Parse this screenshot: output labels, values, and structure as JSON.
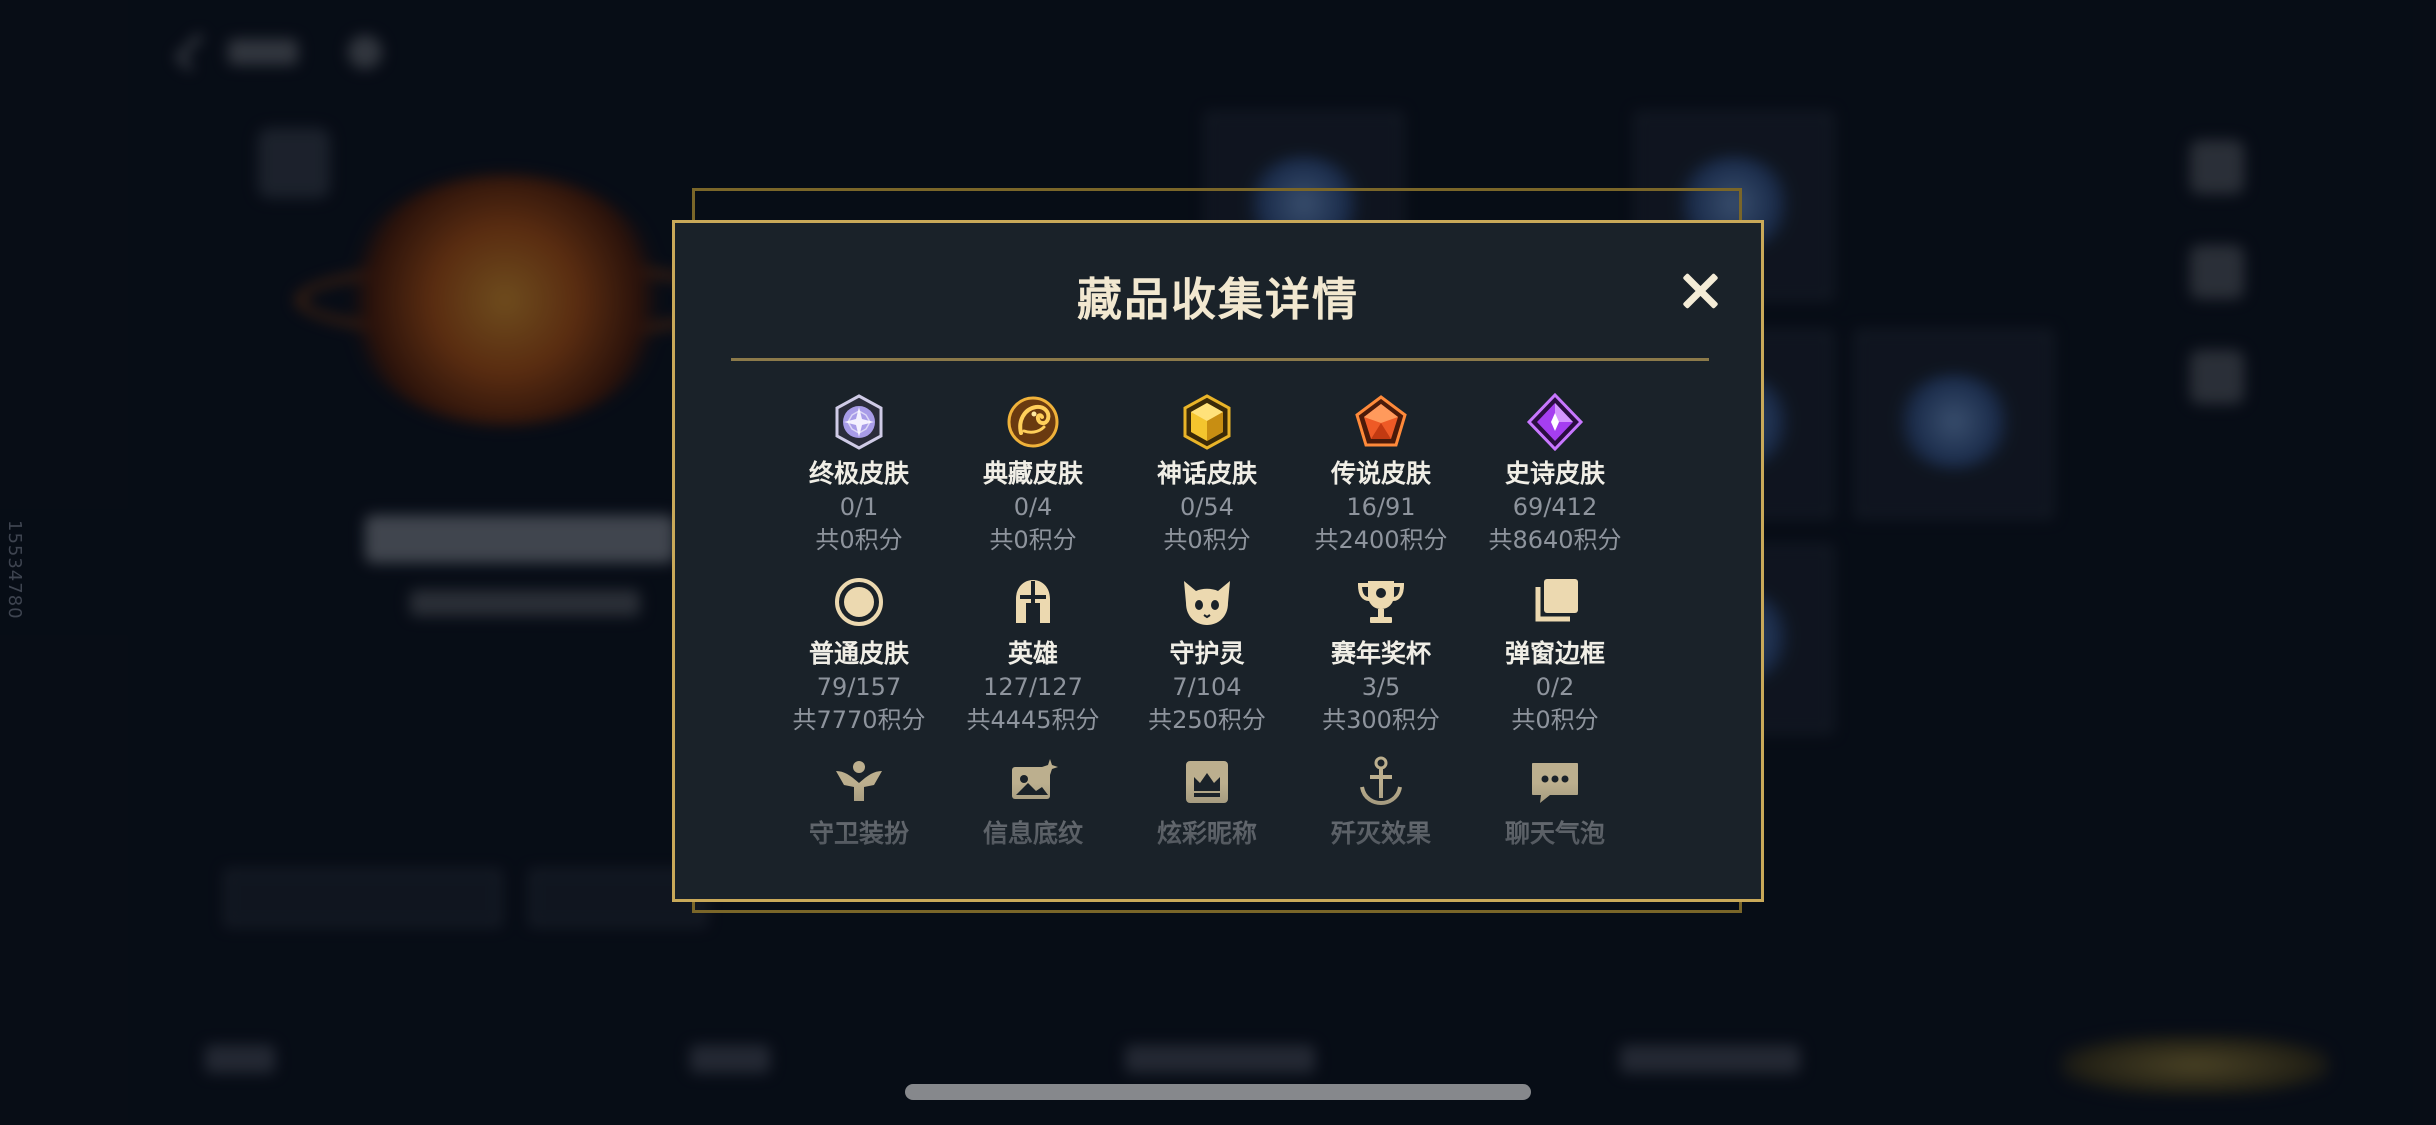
{
  "background": {
    "vertical_id": "15534780"
  },
  "modal": {
    "title": "藏品收集详情",
    "close_icon": "close-icon",
    "colors": {
      "border": "#c9a959",
      "panel": "#1a2229",
      "title": "#f2e8d0",
      "muted": "#8e949d"
    },
    "categories": [
      {
        "key": "ultimate",
        "icon": "ultimate-skin-gem-icon",
        "name": "终极皮肤",
        "count": "0/1",
        "score": "共0积分"
      },
      {
        "key": "collection",
        "icon": "collection-skin-dragon-icon",
        "name": "典藏皮肤",
        "count": "0/4",
        "score": "共0积分"
      },
      {
        "key": "mythic",
        "icon": "mythic-skin-gem-icon",
        "name": "神话皮肤",
        "count": "0/54",
        "score": "共0积分"
      },
      {
        "key": "legend",
        "icon": "legend-skin-gem-icon",
        "name": "传说皮肤",
        "count": "16/91",
        "score": "共2400积分"
      },
      {
        "key": "epic",
        "icon": "epic-skin-gem-icon",
        "name": "史诗皮肤",
        "count": "69/412",
        "score": "共8640积分"
      },
      {
        "key": "normal",
        "icon": "normal-skin-ring-icon",
        "name": "普通皮肤",
        "count": "79/157",
        "score": "共7770积分"
      },
      {
        "key": "hero",
        "icon": "hero-helmet-icon",
        "name": "英雄",
        "count": "127/127",
        "score": "共4445积分"
      },
      {
        "key": "spirit",
        "icon": "guardian-spirit-icon",
        "name": "守护灵",
        "count": "7/104",
        "score": "共250积分"
      },
      {
        "key": "trophy",
        "icon": "trophy-icon",
        "name": "赛年奖杯",
        "count": "3/5",
        "score": "共300积分"
      },
      {
        "key": "frame",
        "icon": "popup-frame-icon",
        "name": "弹窗边框",
        "count": "0/2",
        "score": "共0积分"
      }
    ],
    "partial_categories": [
      {
        "icon": "guard-outfit-icon",
        "name": "守卫装扮"
      },
      {
        "icon": "info-card-icon",
        "name": "信息底纹"
      },
      {
        "icon": "nickname-crown-icon",
        "name": "炫彩昵称"
      },
      {
        "icon": "elimination-effect-icon",
        "name": "歼灭效果"
      },
      {
        "icon": "chat-bubble-icon",
        "name": "聊天气泡"
      }
    ]
  }
}
